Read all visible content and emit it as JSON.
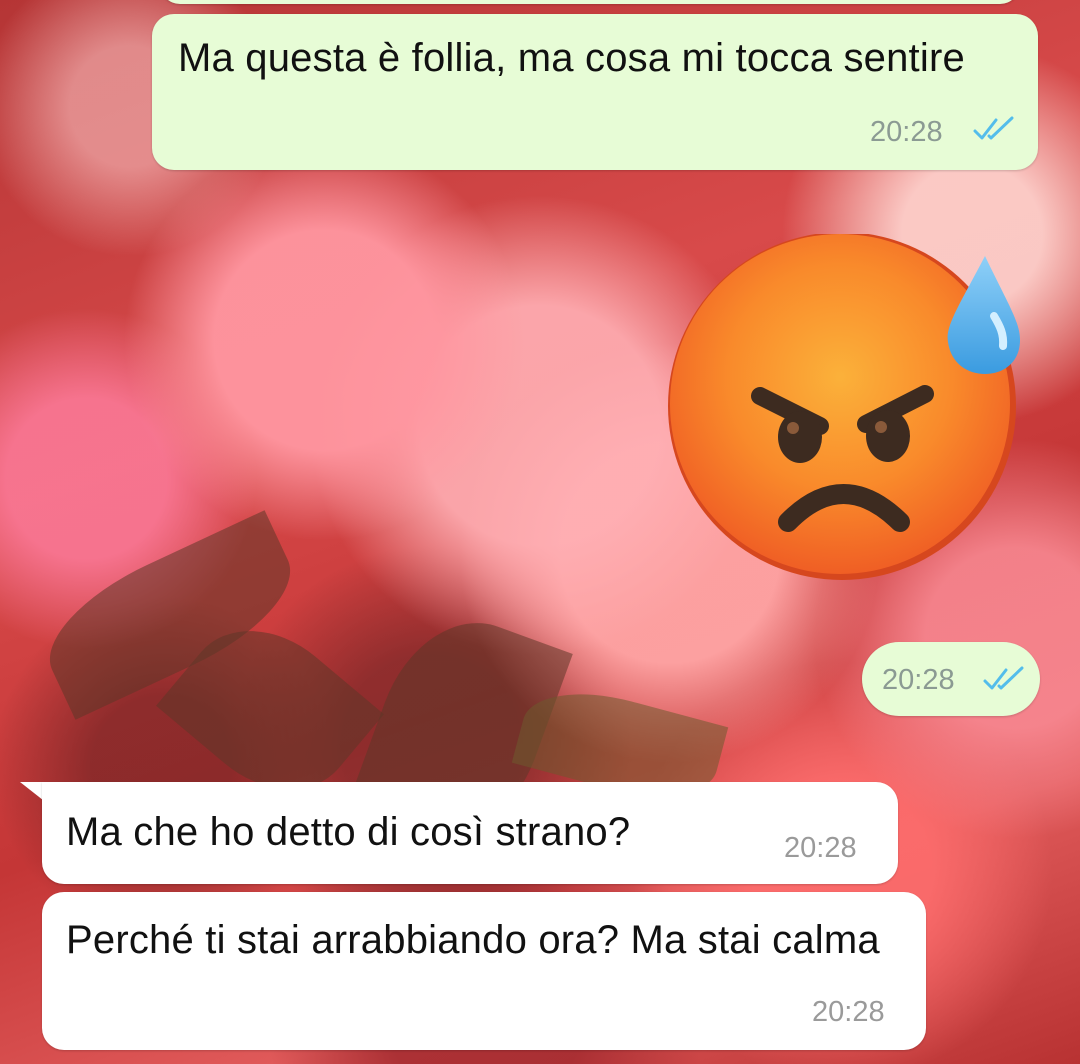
{
  "chat": {
    "messages": [
      {
        "direction": "outgoing",
        "text": "Ma questa è follia, ma cosa mi tocca sentire",
        "time": "20:28",
        "status": "read"
      },
      {
        "direction": "outgoing",
        "type": "emoji",
        "emoji_icon": "angry-face-with-sweat-icon",
        "time": "20:28",
        "status": "read"
      },
      {
        "direction": "incoming",
        "text": "Ma che ho detto di così strano?",
        "time": "20:28"
      },
      {
        "direction": "incoming",
        "text": "Perché ti stai arrabbiando ora? Ma stai calma",
        "time": "20:28"
      }
    ]
  },
  "colors": {
    "outgoing_bubble": "#e7fcd6",
    "incoming_bubble": "#ffffff",
    "read_ticks": "#53bdeb",
    "timestamp": "#8b9a93"
  }
}
